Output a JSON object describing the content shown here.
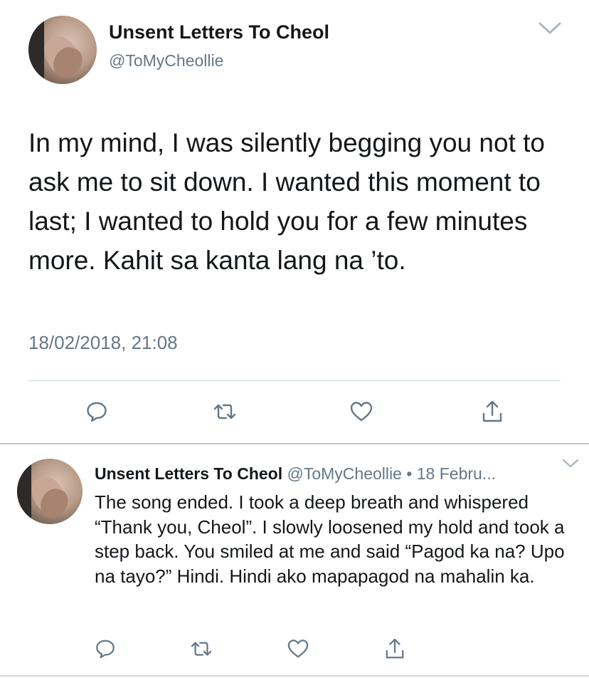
{
  "main_tweet": {
    "display_name": "Unsent Letters To Cheol",
    "handle": "@ToMyCheollie",
    "text": "In my mind, I was silently begging you not to ask me to sit down. I wanted this moment to last; I wanted to hold you for a few minutes more. Kahit sa kanta lang na ’to.",
    "timestamp": "18/02/2018, 21:08",
    "actions": [
      "reply-icon",
      "retweet-icon",
      "like-icon",
      "share-icon"
    ]
  },
  "reply_tweet": {
    "display_name": "Unsent Letters To Cheol",
    "handle": "@ToMyCheollie",
    "separator": "•",
    "date": "18 Febru...",
    "text": "The song ended. I took a deep breath and whispered “Thank you, Cheol”. I slowly loosened my hold and took a step back. You smiled at me and said “Pagod ka na? Upo na tayo?” Hindi. Hindi ako mapapagod na mahalin ka.",
    "actions": [
      "reply-icon",
      "retweet-icon",
      "like-icon",
      "share-icon"
    ]
  },
  "colors": {
    "text_primary": "#14171a",
    "text_secondary": "#657786",
    "icon": "#657786",
    "divider": "#ccd6dd"
  }
}
